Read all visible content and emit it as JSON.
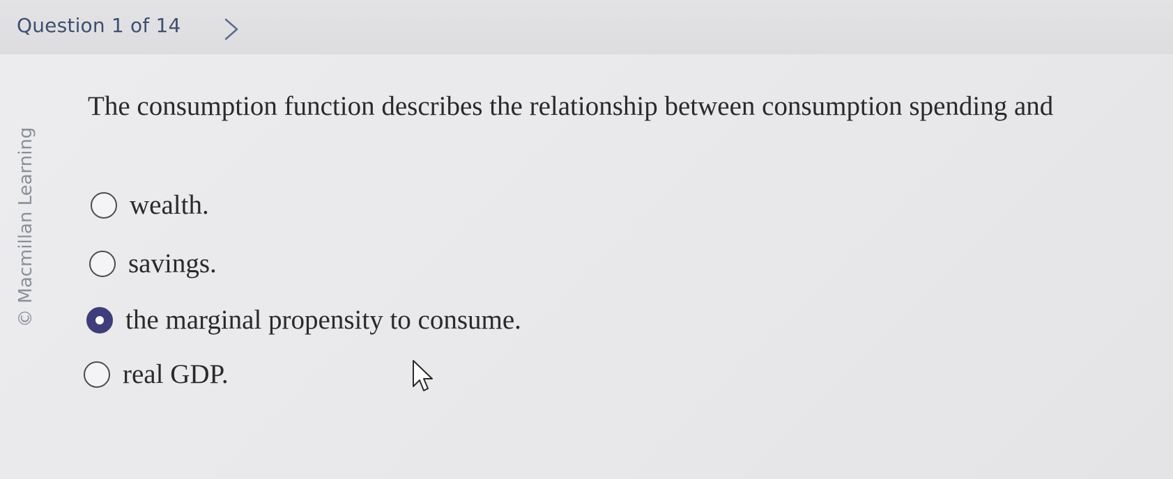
{
  "header": {
    "counter": "Question 1 of 14",
    "next_icon": "chevron-right-icon"
  },
  "watermark": {
    "text": "© Macmillan Learning"
  },
  "question": {
    "text": "The consumption function describes the relationship between consumption spending and"
  },
  "options": [
    {
      "label": "wealth.",
      "selected": false
    },
    {
      "label": "savings.",
      "selected": false
    },
    {
      "label": "the marginal propensity to consume.",
      "selected": true
    },
    {
      "label": "real GDP.",
      "selected": false
    }
  ],
  "colors": {
    "selected_radio": "#3f3d7a",
    "counter_text": "#3e4f6e"
  },
  "cursor_icon": "mouse-pointer-icon"
}
